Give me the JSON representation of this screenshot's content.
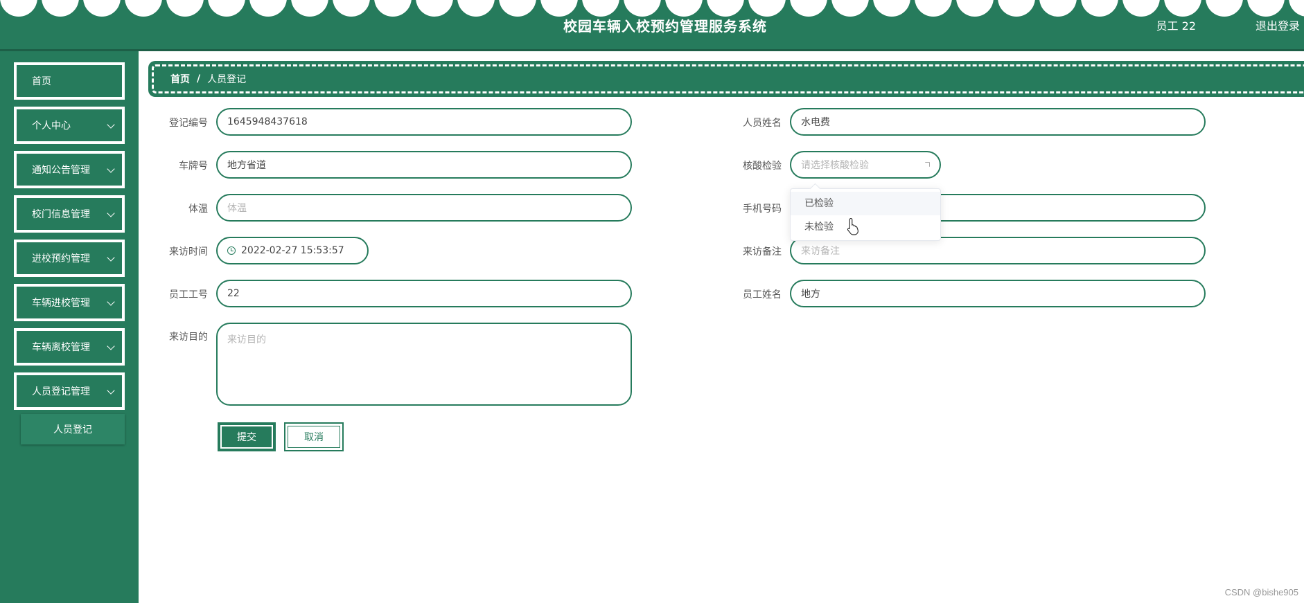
{
  "header": {
    "title": "校园车辆入校预约管理服务系统",
    "user": "员工 22",
    "logout": "退出登录"
  },
  "sidebar": {
    "items": [
      {
        "label": "首页"
      },
      {
        "label": "个人中心"
      },
      {
        "label": "通知公告管理"
      },
      {
        "label": "校门信息管理"
      },
      {
        "label": "进校预约管理"
      },
      {
        "label": "车辆进校管理"
      },
      {
        "label": "车辆离校管理"
      },
      {
        "label": "人员登记管理"
      }
    ],
    "active_sub": "人员登记"
  },
  "breadcrumb": {
    "home": "首页",
    "separator": "/",
    "current": "人员登记"
  },
  "form": {
    "reg_no": {
      "label": "登记编号",
      "value": "1645948437618"
    },
    "person_name": {
      "label": "人员姓名",
      "value": "水电费"
    },
    "plate": {
      "label": "车牌号",
      "value": "地方省道"
    },
    "nucleic": {
      "label": "核酸检验",
      "placeholder": "请选择核酸检验"
    },
    "temp": {
      "label": "体温",
      "placeholder": "体温"
    },
    "phone": {
      "label": "手机号码"
    },
    "visit_time": {
      "label": "来访时间",
      "value": "2022-02-27 15:53:57"
    },
    "visit_note": {
      "label": "来访备注",
      "placeholder": "来访备注"
    },
    "staff_no": {
      "label": "员工工号",
      "value": "22"
    },
    "staff_name": {
      "label": "员工姓名",
      "value": "地方"
    },
    "purpose": {
      "label": "来访目的",
      "placeholder": "来访目的"
    }
  },
  "dropdown": {
    "options": [
      "已检验",
      "未检验"
    ]
  },
  "buttons": {
    "submit": "提交",
    "cancel": "取消"
  },
  "watermark": "CSDN @bishe905",
  "colors": {
    "primary": "#267b5c",
    "white": "#ffffff"
  }
}
